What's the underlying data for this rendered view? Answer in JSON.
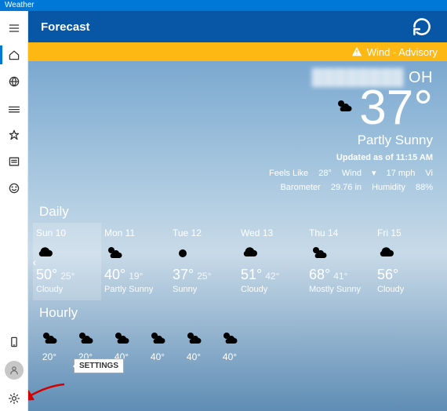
{
  "titlebar": {
    "app_name": "Weather"
  },
  "header": {
    "title": "Forecast"
  },
  "advisory": {
    "text": "Wind - Advisory"
  },
  "hero": {
    "location_prefix_blurred": "████████",
    "location_suffix": " OH",
    "temp": "37°",
    "condition": "Partly Sunny",
    "updated": "Updated as of 11:15 AM",
    "feels_label": "Feels Like",
    "feels_val": "28°",
    "wind_label": "Wind",
    "wind_val": "17 mph",
    "vis_label": "Vi",
    "baro_label": "Barometer",
    "baro_val": "29.76 in",
    "hum_label": "Humidity",
    "hum_val": "88%"
  },
  "sections": {
    "daily": "Daily",
    "hourly": "Hourly"
  },
  "daily": [
    {
      "name": "Sun 10",
      "hi": "50°",
      "lo": "25°",
      "cond": "Cloudy",
      "icon": "cloud",
      "today": true
    },
    {
      "name": "Mon 11",
      "hi": "40°",
      "lo": "19°",
      "cond": "Partly Sunny",
      "icon": "partly",
      "today": false
    },
    {
      "name": "Tue 12",
      "hi": "37°",
      "lo": "25°",
      "cond": "Sunny",
      "icon": "sun",
      "today": false
    },
    {
      "name": "Wed 13",
      "hi": "51°",
      "lo": "42°",
      "cond": "Cloudy",
      "icon": "cloud",
      "today": false
    },
    {
      "name": "Thu 14",
      "hi": "68°",
      "lo": "41°",
      "cond": "Mostly Sunny",
      "icon": "partly",
      "today": false
    },
    {
      "name": "Fri 15",
      "hi": "56°",
      "lo": "",
      "cond": "Cloudy",
      "icon": "cloud",
      "today": false
    }
  ],
  "hourly": [
    {
      "temp": "20°",
      "icon": "partly"
    },
    {
      "temp": "20°",
      "icon": "partly"
    },
    {
      "temp": "40°",
      "icon": "partly"
    },
    {
      "temp": "40°",
      "icon": "partly"
    },
    {
      "temp": "40°",
      "icon": "partly"
    },
    {
      "temp": "40°",
      "icon": "partly"
    }
  ],
  "tooltip": {
    "settings": "SETTINGS"
  }
}
